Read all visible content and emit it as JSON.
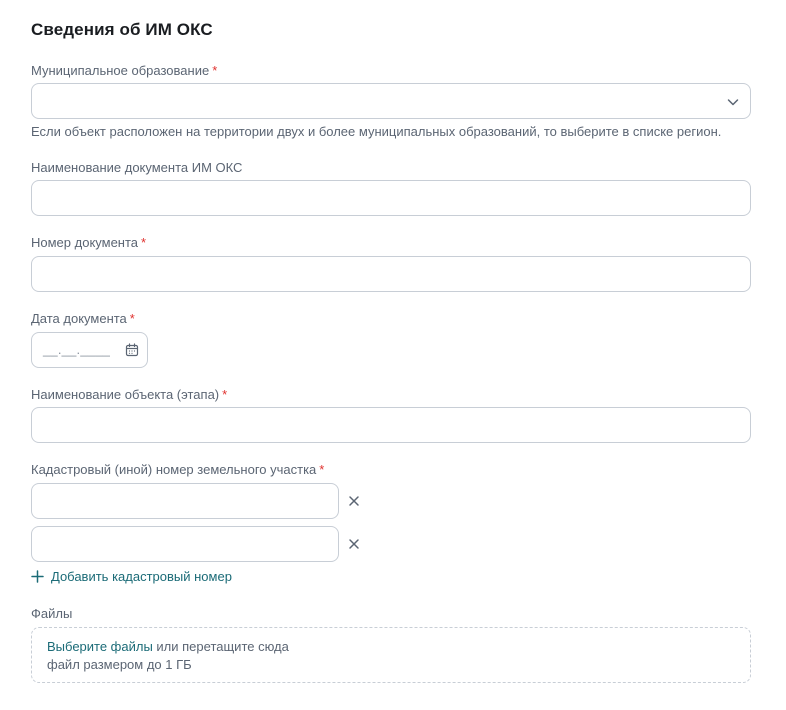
{
  "section": {
    "title": "Сведения об ИМ ОКС"
  },
  "fields": {
    "municipality": {
      "label": "Муниципальное образование",
      "required_mark": "*",
      "value": "",
      "hint": "Если объект расположен на территории двух и более муниципальных образований, то выберите в списке регион."
    },
    "doc_name": {
      "label": "Наименование документа ИМ ОКС",
      "value": ""
    },
    "doc_number": {
      "label": "Номер документа",
      "required_mark": "*",
      "value": ""
    },
    "doc_date": {
      "label": "Дата документа",
      "required_mark": "*",
      "placeholder": "__.__.____"
    },
    "object_name": {
      "label": "Наименование объекта (этапа)",
      "required_mark": "*",
      "value": ""
    },
    "cadastral": {
      "label": "Кадастровый (иной) номер земельного участка",
      "required_mark": "*",
      "entries": [
        "",
        ""
      ],
      "add_label": "Добавить кадастровый номер"
    },
    "files": {
      "label": "Файлы",
      "select_link": "Выберите файлы",
      "drop_text": " или перетащите сюда",
      "size_hint": "файл размером до 1 ГБ"
    }
  },
  "colors": {
    "required": "#e0312e",
    "link": "#1b6b77",
    "border": "#c8ced6",
    "label": "#5b6573"
  },
  "icons": {
    "dropdown": "chevron-down-icon",
    "calendar": "calendar-icon",
    "remove": "close-icon",
    "add": "plus-icon"
  }
}
